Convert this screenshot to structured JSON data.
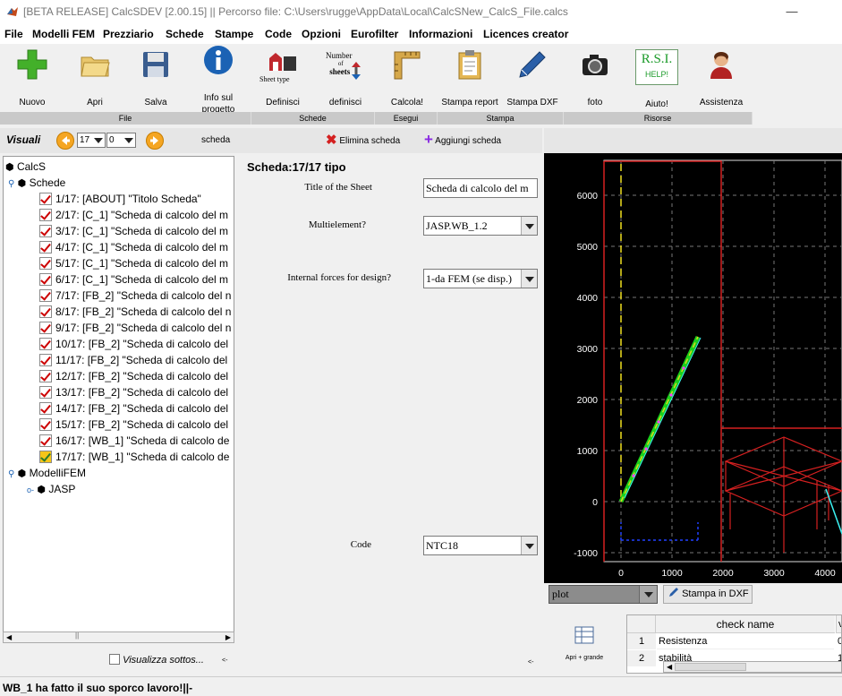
{
  "window": {
    "title": "[BETA RELEASE] CalcSDEV [2.00.15] || Percorso file: C:\\Users\\rugge\\AppData\\Local\\CalcSNew_CalcS_File.calcs",
    "minimize": "—",
    "maximize": "☐",
    "close": "✕"
  },
  "menu": [
    "File",
    "Modelli FEM",
    "Prezziario",
    "Schede",
    "Stampe",
    "Code",
    "Opzioni",
    "Eurofilter",
    "Informazioni",
    "Licences creator"
  ],
  "toolbar": {
    "buttons": [
      {
        "label": "Nuovo",
        "icon": "plus-icon"
      },
      {
        "label": "Apri",
        "icon": "folder-icon"
      },
      {
        "label": "Salva",
        "icon": "floppy-icon"
      },
      {
        "label": "Info sul progetto",
        "icon": "info-icon"
      },
      {
        "label": "Definisci",
        "icon": "sheet-type-icon",
        "icon_text": "Sheet type"
      },
      {
        "label": "definisci",
        "icon": "number-of-sheets-icon",
        "icon_text_1": "Number",
        "icon_text_2": "of",
        "icon_text_3": "sheets"
      },
      {
        "label": "Calcola!",
        "icon": "square-ruler-icon"
      },
      {
        "label": "Stampa report",
        "icon": "clipboard-icon"
      },
      {
        "label": "Stampa DXF",
        "icon": "pen-icon"
      },
      {
        "label": "foto",
        "icon": "camera-icon"
      },
      {
        "label": "Aiuto!",
        "icon": "rsi-help-icon",
        "icon_text_1": "R.S.I.",
        "icon_text_2": "HELP!"
      },
      {
        "label": "Assistenza",
        "icon": "assistant-icon"
      }
    ],
    "groups": [
      "File",
      "Schede",
      "Esegui",
      "Stampa",
      "Risorse"
    ]
  },
  "visuali": {
    "label": "Visuali",
    "spin1": "17",
    "spin2": "0",
    "scheda": "scheda"
  },
  "scheda_actions": {
    "delete": "Elimina scheda",
    "add": "Aggiungi scheda"
  },
  "tree": {
    "root": "CalcS",
    "schede_label": "Schede",
    "items": [
      "1/17: [ABOUT] \"Titolo Scheda\"",
      "2/17: [C_1] \"Scheda di calcolo del m",
      "3/17: [C_1] \"Scheda di calcolo del m",
      "4/17: [C_1] \"Scheda di calcolo del m",
      "5/17: [C_1] \"Scheda di calcolo del m",
      "6/17: [C_1] \"Scheda di calcolo del m",
      "7/17: [FB_2] \"Scheda di calcolo del n",
      "8/17: [FB_2] \"Scheda di calcolo del n",
      "9/17: [FB_2] \"Scheda di calcolo del n",
      "10/17: [FB_2] \"Scheda di calcolo del",
      "11/17: [FB_2] \"Scheda di calcolo del",
      "12/17: [FB_2] \"Scheda di calcolo del",
      "13/17: [FB_2] \"Scheda di calcolo del",
      "14/17: [FB_2] \"Scheda di calcolo del",
      "15/17: [FB_2] \"Scheda di calcolo del",
      "16/17: [WB_1] \"Scheda di calcolo de",
      "17/17: [WB_1] \"Scheda di calcolo de"
    ],
    "modelli_label": "ModelliFEM",
    "jasp_label": "JASP"
  },
  "visualizza": {
    "label": "Visualizza sottos...",
    "marker": "<-"
  },
  "form": {
    "heading": "Scheda:17/17 tipo",
    "title_label": "Title of the Sheet",
    "title_value": "Scheda di calcolo del m",
    "multi_label": "Multielement?",
    "multi_value": "JASP.WB_1.2",
    "forces_label": "Internal forces for design?",
    "forces_value": "1-da FEM (se disp.)",
    "code_label": "Code",
    "code_value": "NTC18",
    "marker": "<-"
  },
  "plot": {
    "y_ticks": [
      "6000",
      "5000",
      "4000",
      "3000",
      "2000",
      "1000",
      "0",
      "-1000"
    ],
    "x_ticks": [
      "0",
      "1000",
      "2000",
      "3000",
      "4000"
    ],
    "select_value": "plot",
    "dxf_button": "Stampa in DXF"
  },
  "check_table": {
    "side_button": "Apri + grande",
    "header": "check name",
    "header_extra": "v",
    "rows": [
      {
        "n": "1",
        "name": "Resistenza",
        "v": "0"
      },
      {
        "n": "2",
        "name": "stabilità",
        "v": "1"
      }
    ]
  },
  "status": "WB_1 ha fatto il suo sporco lavoro!||-"
}
